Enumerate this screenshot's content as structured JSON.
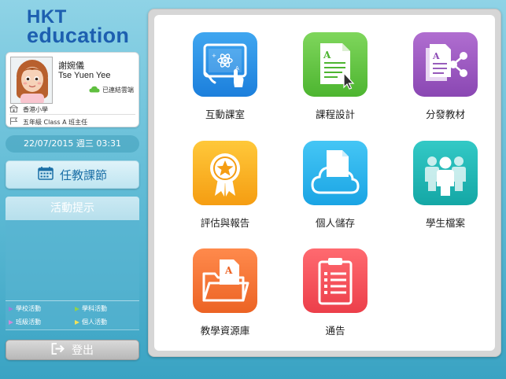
{
  "logo": {
    "line1": "HKT",
    "line2": "education"
  },
  "profile": {
    "name_cn": "謝婉儀",
    "name_en": "Tse Yuen Yee",
    "cloud_status": "已連結雲端",
    "school": "香港小學",
    "role": "五年級 Class A 班主任"
  },
  "datetime": "22/07/2015 週三 03:31",
  "teaching_button": {
    "label": "任教課節",
    "icon": "calendar-icon"
  },
  "activity": {
    "header": "活動提示",
    "legend": [
      {
        "label": "學校活動",
        "color": "#9b7fd6"
      },
      {
        "label": "學科活動",
        "color": "#8fd14f"
      },
      {
        "label": "班級活動",
        "color": "#d08ad8"
      },
      {
        "label": "個人活動",
        "color": "#f2e15a"
      }
    ]
  },
  "logout": {
    "label": "登出",
    "icon": "logout-icon"
  },
  "tiles": [
    {
      "label": "互動課室",
      "icon": "interactive-classroom-icon",
      "color": "#2a8fe6"
    },
    {
      "label": "課程設計",
      "icon": "document-pointer-icon",
      "color": "#5dc23e"
    },
    {
      "label": "分發教材",
      "icon": "share-document-icon",
      "color": "#9a58c2"
    },
    {
      "label": "評估與報告",
      "icon": "award-ribbon-icon",
      "color": "#f7ad1f"
    },
    {
      "label": "個人儲存",
      "icon": "cloud-storage-icon",
      "color": "#2bb2ea"
    },
    {
      "label": "學生檔案",
      "icon": "people-icon",
      "color": "#1db6b3"
    },
    {
      "label": "教學資源庫",
      "icon": "folder-icon",
      "color": "#f27232"
    },
    {
      "label": "通告",
      "icon": "clipboard-icon",
      "color": "#f2525b"
    }
  ]
}
